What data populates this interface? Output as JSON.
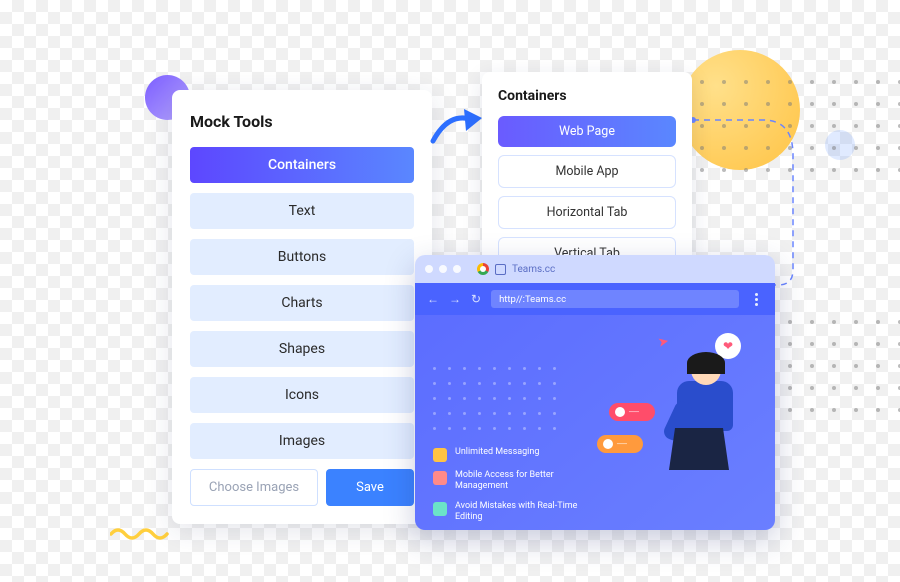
{
  "mock": {
    "title": "Mock Tools",
    "items": [
      "Containers",
      "Text",
      "Buttons",
      "Charts",
      "Shapes",
      "Icons",
      "Images"
    ],
    "choose": "Choose Images",
    "save": "Save"
  },
  "containers": {
    "title": "Containers",
    "items": [
      "Web Page",
      "Mobile App",
      "Horizontal Tab",
      "Vertical Tab"
    ]
  },
  "browser": {
    "tab": "Teams.cc",
    "url": "http//:Teams.cc",
    "features": [
      "Unlimited Messaging",
      "Mobile Access for Better Management",
      "Avoid Mistakes with Real-Time Editing"
    ]
  }
}
